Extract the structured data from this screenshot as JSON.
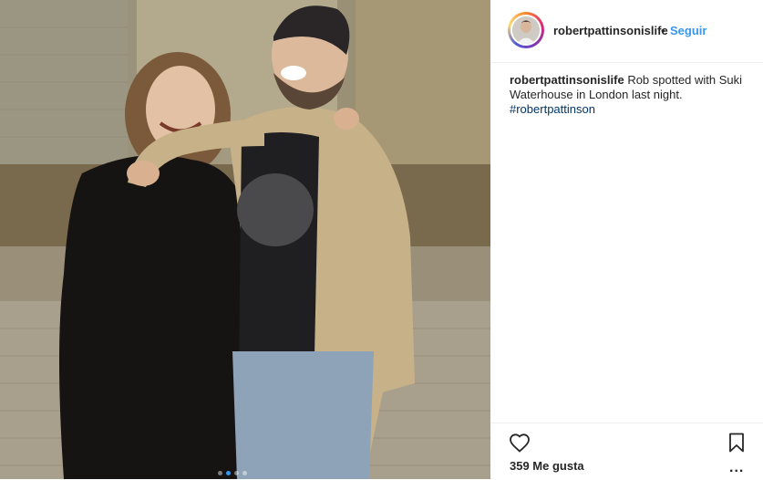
{
  "post": {
    "image_alt": "Photo of two people laughing on a street at night",
    "carousel_dots": 4,
    "carousel_active": 1
  },
  "header": {
    "username": "robertpattinsonislife",
    "separator": "•",
    "follow_label": "Seguir"
  },
  "caption": {
    "username": "robertpattinsonislife",
    "text": "Rob spotted with Suki Waterhouse in London last night.",
    "hashtag": "#robertpattinson"
  },
  "actions": {
    "like_icon": "heart-icon",
    "save_icon": "bookmark-icon",
    "more_icon": "more-options-icon",
    "likes_text": "359 Me gusta",
    "more_label": "..."
  },
  "colors": {
    "link_blue": "#3897f0",
    "hashtag": "#003569",
    "text": "#262626",
    "border": "#efefef"
  }
}
